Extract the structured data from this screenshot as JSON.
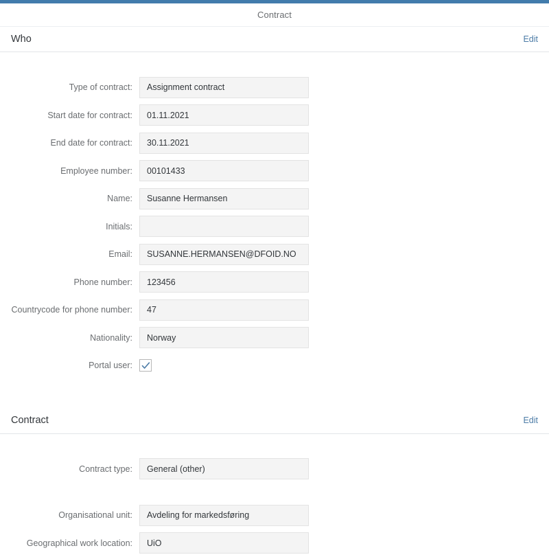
{
  "theme": {
    "accent_bar_color": "#427cac",
    "link_color": "#4c7ca7",
    "label_color": "#6a6d70",
    "value_bg_color": "#f4f4f4",
    "page_bg_color": "#ffffff"
  },
  "header": {
    "page_title": "Contract"
  },
  "sections": [
    {
      "id": "who",
      "title": "Who",
      "edit_label": "Edit",
      "fields": [
        {
          "label": "Type of contract:",
          "value": "Assignment contract",
          "type": "text"
        },
        {
          "label": "Start date for contract:",
          "value": "01.11.2021",
          "type": "text"
        },
        {
          "label": "End date for contract:",
          "value": "30.11.2021",
          "type": "text"
        },
        {
          "label": "Employee number:",
          "value": "00101433",
          "type": "text"
        },
        {
          "label": "Name:",
          "value": "Susanne Hermansen",
          "type": "text"
        },
        {
          "label": "Initials:",
          "value": "",
          "type": "text"
        },
        {
          "label": "Email:",
          "value": "SUSANNE.HERMANSEN@DFOID.NO",
          "type": "text"
        },
        {
          "label": "Phone number:",
          "value": "123456",
          "type": "text"
        },
        {
          "label": "Countrycode for phone number:",
          "value": "47",
          "type": "text"
        },
        {
          "label": "Nationality:",
          "value": "Norway",
          "type": "text"
        },
        {
          "label": "Portal user:",
          "value": "checked",
          "type": "checkbox"
        }
      ]
    },
    {
      "id": "contract",
      "title": "Contract",
      "edit_label": "Edit",
      "fields": [
        {
          "label": "Contract type:",
          "value": "General (other)",
          "type": "text"
        },
        {
          "label": "Organisational unit:",
          "value": "Avdeling for markedsføring",
          "type": "text"
        },
        {
          "label": "Geographical work location:",
          "value": "UiO",
          "type": "text"
        }
      ]
    }
  ]
}
